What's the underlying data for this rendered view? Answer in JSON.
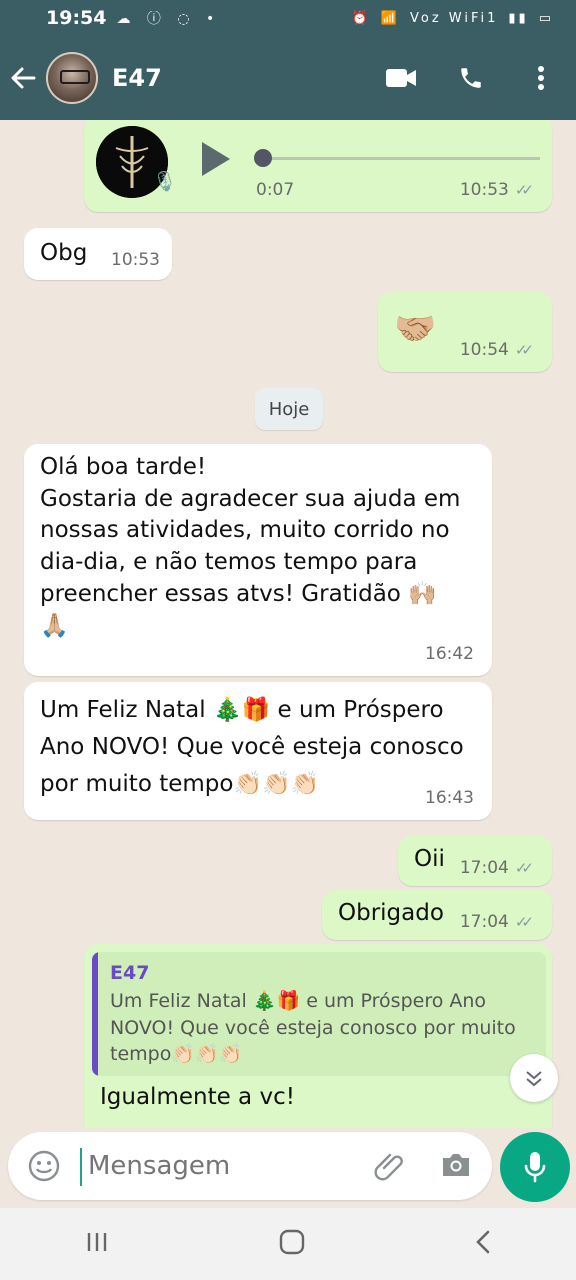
{
  "status": {
    "time": "19:54",
    "left_icons": "☁ ⓘ ◌ •",
    "right_text": "Voz WiFi1"
  },
  "header": {
    "contact_name": "E47"
  },
  "messages": [
    {
      "type": "voice",
      "duration": "0:07",
      "time": "10:53"
    },
    {
      "type": "in",
      "text": "Obg",
      "time": "10:53"
    },
    {
      "type": "out",
      "text": "🤝🏼",
      "time": "10:54"
    },
    {
      "type": "day",
      "text": "Hoje"
    },
    {
      "type": "in",
      "text": "Olá boa tarde!\nGostaria de agradecer sua ajuda em nossas atividades, muito corrido no dia-dia, e não temos tempo para preencher essas atvs! Gratidão 🙌🏼\n🙏🏼",
      "time": "16:42"
    },
    {
      "type": "in",
      "text": "Um Feliz Natal 🎄🎁 e um Próspero Ano NOVO! Que você esteja conosco por muito tempo👏🏻👏🏻👏🏻",
      "time": "16:43"
    },
    {
      "type": "out",
      "text": "Oii",
      "time": "17:04"
    },
    {
      "type": "out",
      "text": "Obrigado",
      "time": "17:04"
    },
    {
      "type": "out-reply",
      "quote_name": "E47",
      "quote_text": "Um Feliz Natal 🎄🎁 e um Próspero Ano NOVO! Que você esteja conosco por muito tempo👏🏻👏🏻👏🏻",
      "text": "Igualmente a vc!"
    }
  ],
  "composer": {
    "placeholder": "Mensagem"
  },
  "colors": {
    "header": "#3a5e63",
    "chat_bg": "#efe7dd",
    "out_bubble": "#dbf8c6",
    "in_bubble": "#ffffff",
    "mic": "#08a884"
  },
  "icons": [
    "back-arrow-icon",
    "video-call-icon",
    "phone-icon",
    "more-vert-icon",
    "play-icon",
    "mic-icon",
    "emoji-icon",
    "attach-icon",
    "camera-icon",
    "chevron-down-icon"
  ]
}
